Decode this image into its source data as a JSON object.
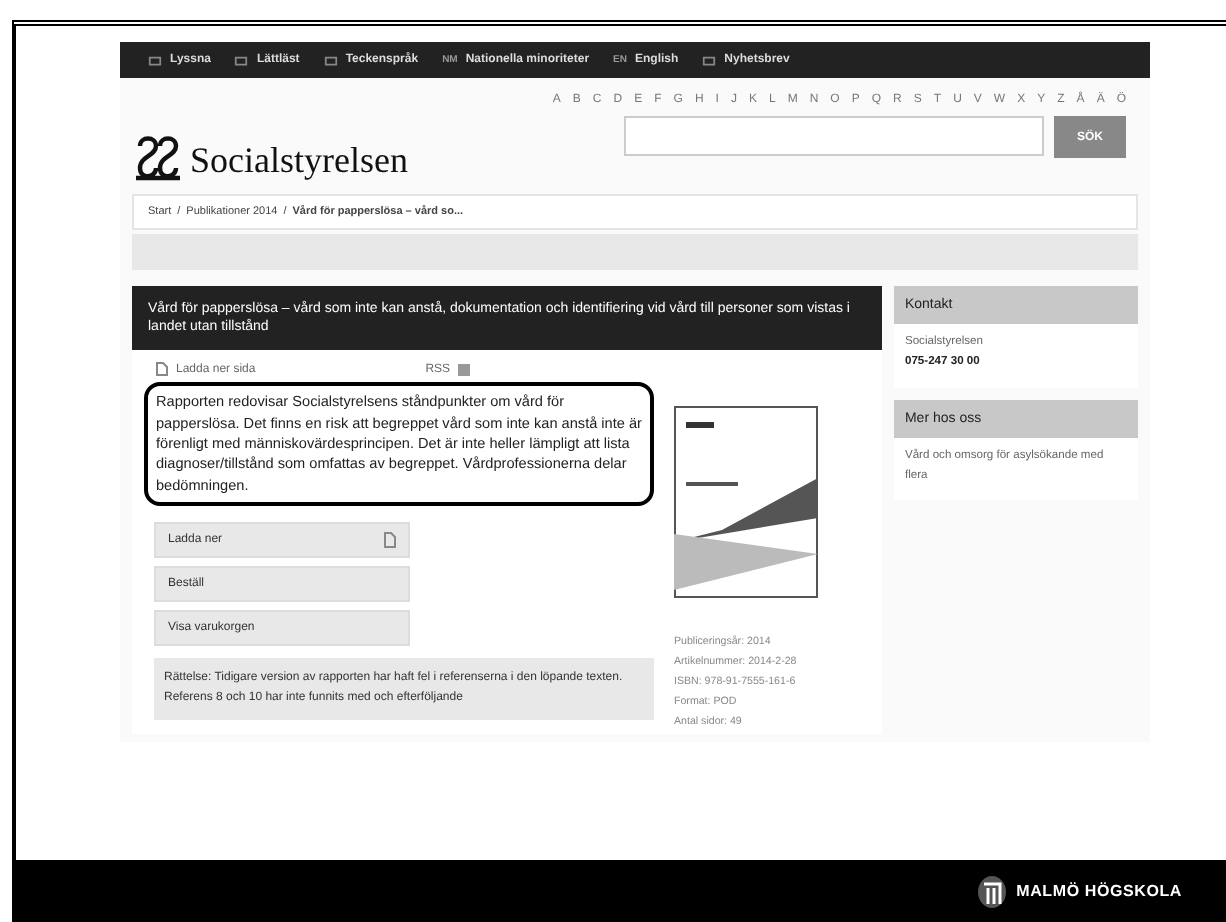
{
  "top_nav": [
    {
      "label": "Lyssna"
    },
    {
      "label": "Lättläst"
    },
    {
      "label": "Teckenspråk"
    },
    {
      "label": "Nationella minoriteter",
      "badge": "NM"
    },
    {
      "label": "English",
      "badge": "EN"
    },
    {
      "label": "Nyhetsbrev"
    }
  ],
  "logo": {
    "name": "Socialstyrelsen"
  },
  "alphabet": [
    "A",
    "B",
    "C",
    "D",
    "E",
    "F",
    "G",
    "H",
    "I",
    "J",
    "K",
    "L",
    "M",
    "N",
    "O",
    "P",
    "Q",
    "R",
    "S",
    "T",
    "U",
    "V",
    "W",
    "X",
    "Y",
    "Z",
    "Å",
    "Ä",
    "Ö"
  ],
  "search": {
    "button": "SÖK"
  },
  "breadcrumb": [
    {
      "label": "Start",
      "current": false
    },
    {
      "separator": "/",
      "label": "Publikationer 2014",
      "current": false
    },
    {
      "separator": "/",
      "label": "Vård för papperslösa – vård so...",
      "current": true
    }
  ],
  "article": {
    "title": "Vård för papperslösa – vård som inte kan anstå, dokumentation och identifiering vid vård till personer som vistas i landet utan tillstånd",
    "download_page": "Ladda ner sida",
    "rss": "RSS",
    "summary": "Rapporten redovisar Socialstyrelsens ståndpunkter om vård för papperslösa. Det finns en risk att begreppet vård som inte kan anstå inte är förenligt med människovärdesprincipen. Det är inte heller lämpligt att lista diagnoser/tillstånd som omfattas av begreppet. Vårdprofessionerna delar bedömningen.",
    "actions": [
      {
        "label": "Ladda ner",
        "kind": "download"
      },
      {
        "label": "Beställ",
        "kind": "plain"
      },
      {
        "label": "Visa varukorgen",
        "kind": "plain"
      }
    ],
    "notice": "Rättelse: Tidigare version av rapporten har haft fel i referenserna i den löpande texten. Referens 8 och 10 har inte funnits med och efterföljande",
    "meta": [
      "Publiceringsår: 2014",
      "Artikelnummer: 2014-2-28",
      "ISBN: 978-91-7555-161-6",
      "Format: POD",
      "Antal sidor: 49"
    ]
  },
  "sidebar": [
    {
      "heading": "Kontakt",
      "lines": [
        {
          "text": "Socialstyrelsen",
          "bold": false
        },
        {
          "text": "075-247 30 00",
          "bold": true
        }
      ]
    },
    {
      "heading": "Mer hos oss",
      "lines": [
        {
          "text": "Vård och omsorg för asylsökande med flera",
          "bold": false
        }
      ]
    }
  ],
  "footer": {
    "brand": "MALMÖ HÖGSKOLA"
  }
}
